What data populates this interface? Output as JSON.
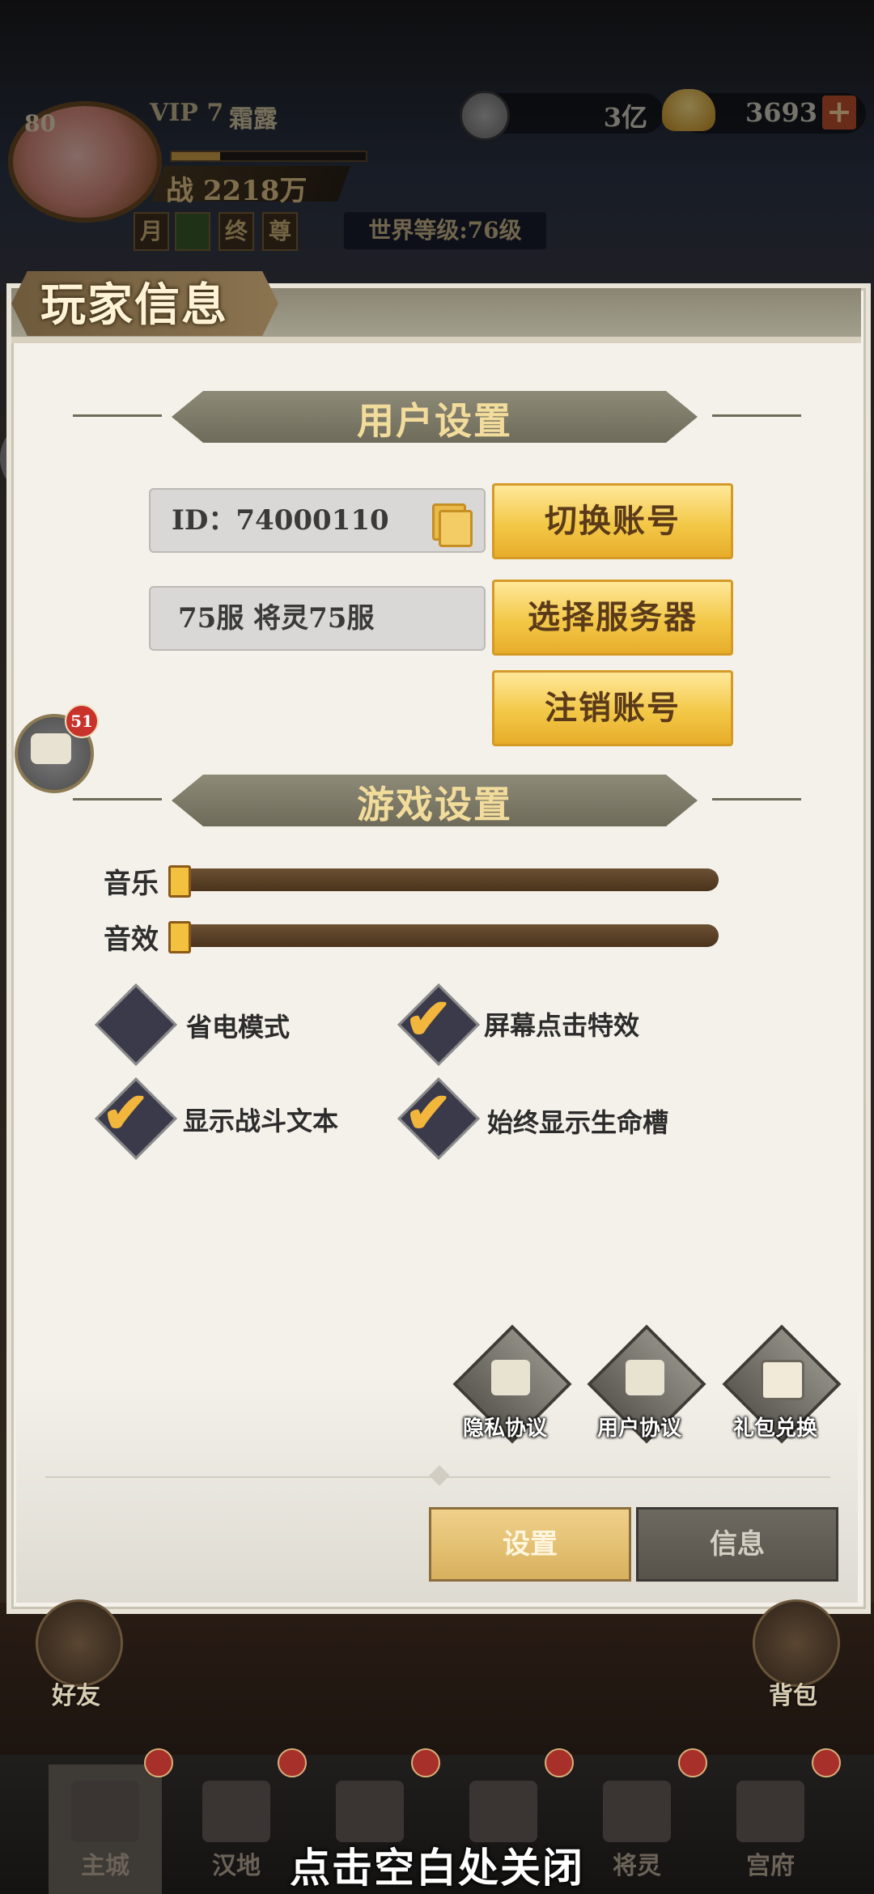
{
  "hud": {
    "level": "80",
    "vip": "VIP 7",
    "player_name": "霜露",
    "power": "战 2218万",
    "flags": [
      "月",
      "",
      "终",
      "尊"
    ],
    "world_level": "世界等级:76级",
    "silver": "3亿",
    "gold": "3693",
    "gold_add": "+"
  },
  "chat": {
    "badge": "51"
  },
  "panel": {
    "title": "玩家信息",
    "user_section": "用户设置",
    "account_id": "ID：74000110",
    "server": "75服  将灵75服",
    "switch_account": "切换账号",
    "select_server": "选择服务器",
    "logout": "注销账号",
    "game_section": "游戏设置",
    "music_label": "音乐",
    "sfx_label": "音效",
    "music_level": 0,
    "sfx_level": 0,
    "options": [
      {
        "label": "省电模式",
        "checked": false
      },
      {
        "label": "屏幕点击特效",
        "checked": true
      },
      {
        "label": "显示战斗文本",
        "checked": true
      },
      {
        "label": "始终显示生命槽",
        "checked": true
      }
    ],
    "links": [
      "隐私协议",
      "用户协议",
      "礼包兑换"
    ],
    "tabs": {
      "settings": "设置",
      "info": "信息"
    }
  },
  "side_buttons": {
    "friends": "好友",
    "bag": "背包"
  },
  "nav": {
    "items": [
      "主城",
      "汉地",
      "",
      "",
      "将灵",
      "宫府"
    ]
  },
  "close_hint": "点击空白处关闭"
}
